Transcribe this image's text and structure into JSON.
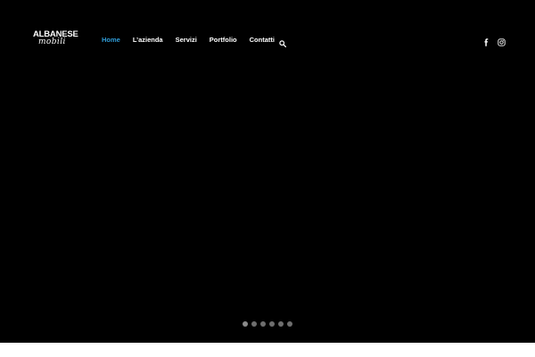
{
  "logo": {
    "line1": "ALBANESE",
    "line2": "mobili"
  },
  "nav": {
    "items": [
      {
        "label": "Home",
        "active": true
      },
      {
        "label": "L’azienda",
        "active": false
      },
      {
        "label": "Servizi",
        "active": false
      },
      {
        "label": "Portfolio",
        "active": false
      },
      {
        "label": "Contatti",
        "active": false
      }
    ],
    "search_icon": "search-icon"
  },
  "social": {
    "icons": [
      "facebook-icon",
      "instagram-icon"
    ]
  },
  "slider": {
    "slide_count": 6,
    "active_slide": 1
  },
  "colors": {
    "hero_background": "#000000",
    "page_background": "#ffffff",
    "nav_text": "#ffffff",
    "nav_active": "#2f9bd6",
    "dot": "#6e6e6e"
  }
}
